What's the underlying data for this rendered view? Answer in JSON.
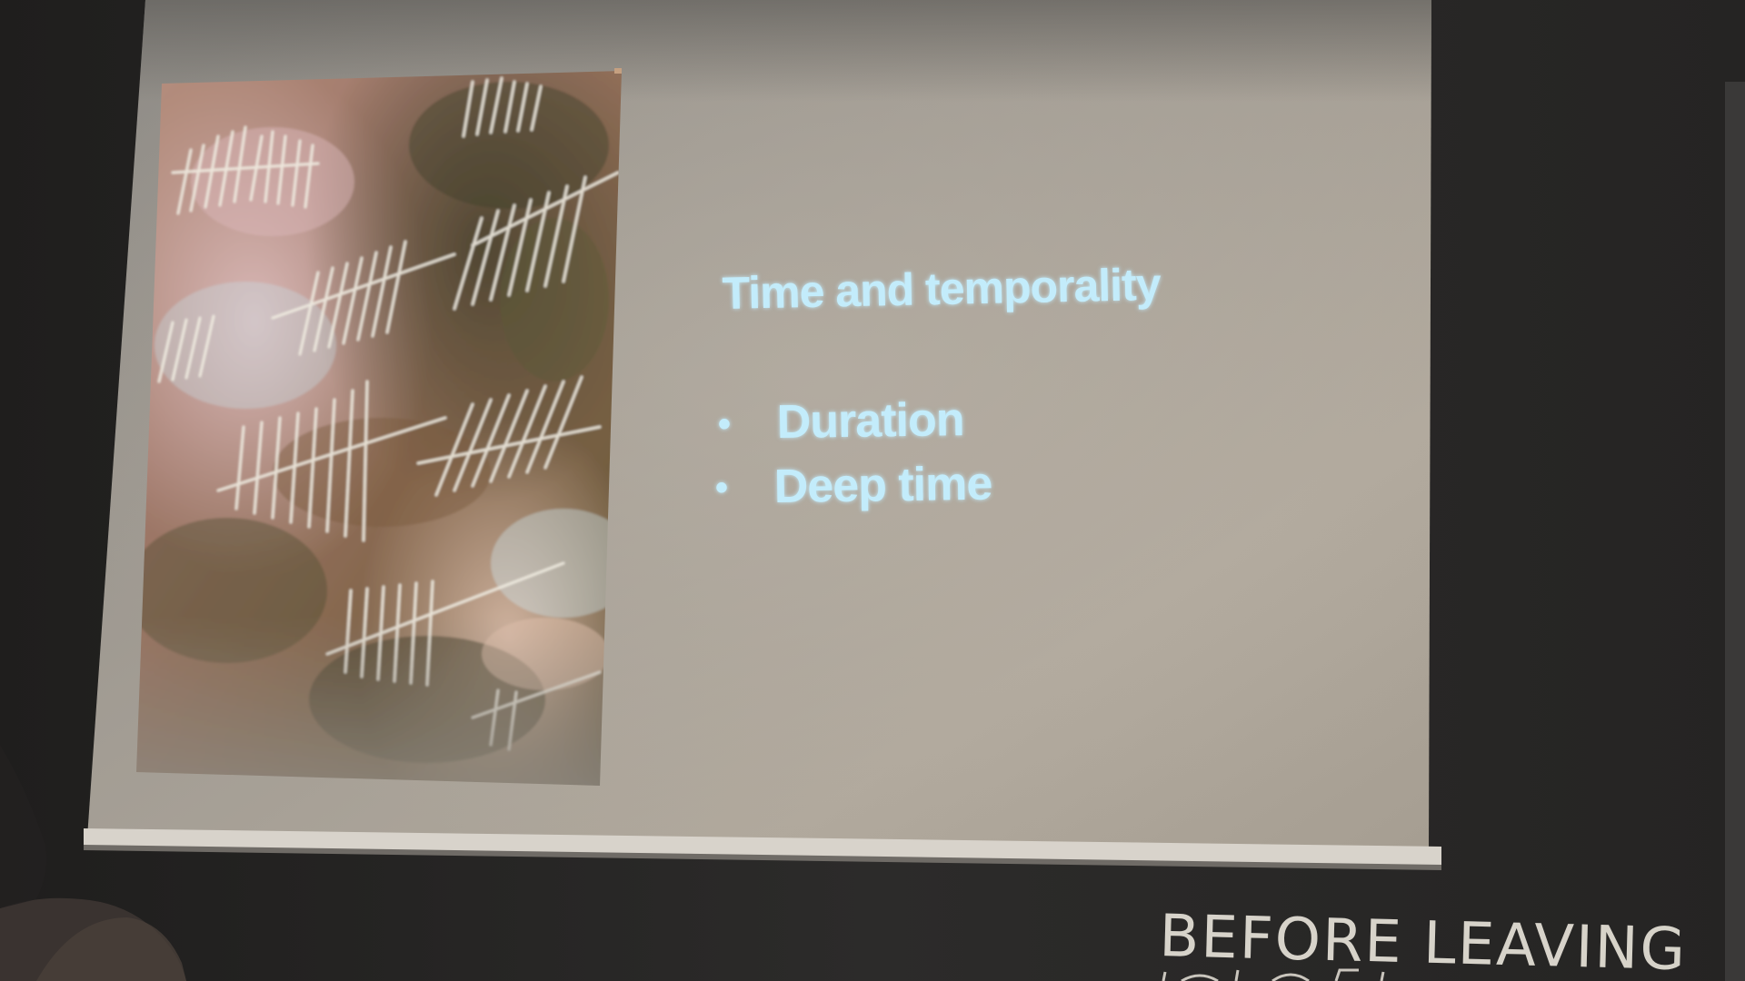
{
  "slide": {
    "title": "Time and temporality",
    "bullets": [
      "Duration",
      "Deep time"
    ],
    "bullet_glyph": "•",
    "image": {
      "subject": "rock-engraved-tally-marks"
    }
  },
  "wall": {
    "chalk_text": "BEFORE LEAVING"
  },
  "colors": {
    "wall": "#2b2a29",
    "screen_light": "#b3aa9e",
    "screen_dark": "#8c877f",
    "slide_text": "#bfe9f8",
    "chalk": "#e6e2d8"
  }
}
